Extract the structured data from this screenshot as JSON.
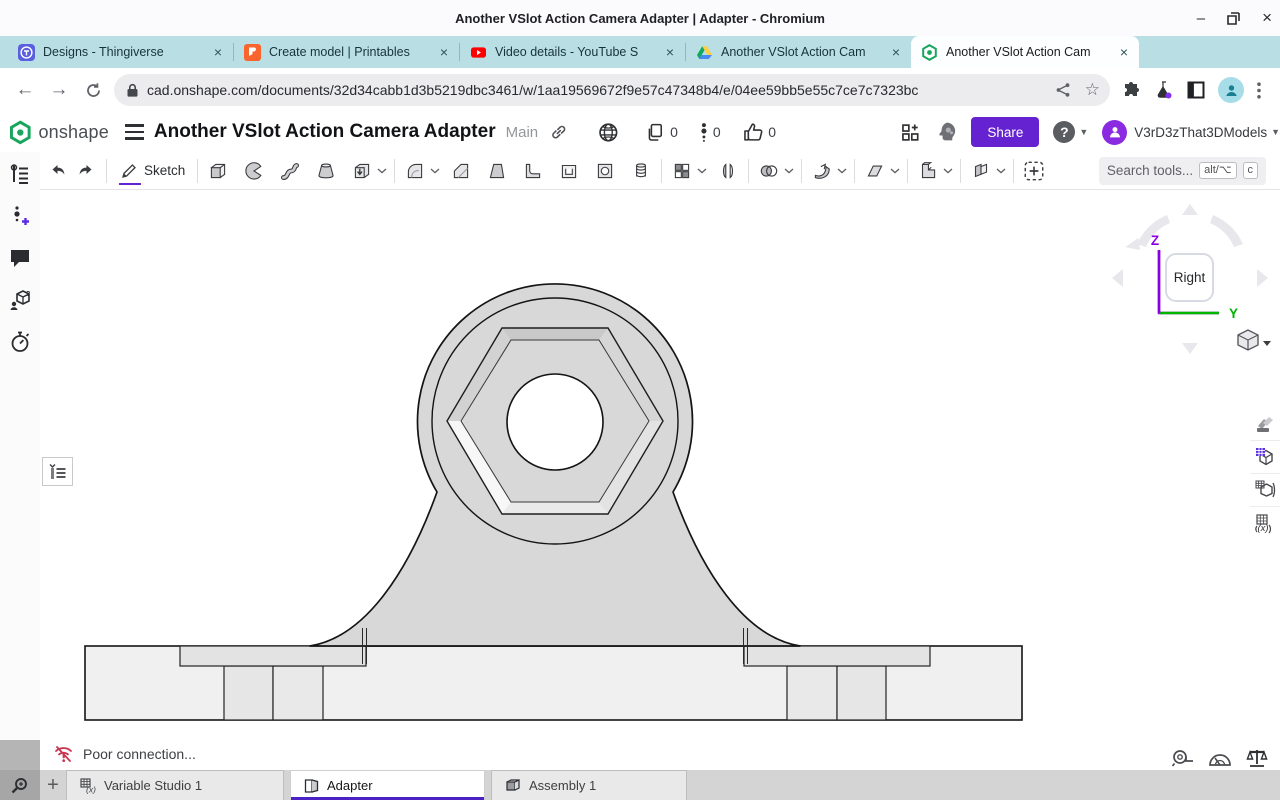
{
  "window": {
    "title": "Another VSlot Action Camera Adapter | Adapter - Chromium"
  },
  "browser": {
    "tabs": [
      {
        "label": "Designs - Thingiverse",
        "icon": "thingiverse"
      },
      {
        "label": "Create model | Printables",
        "icon": "printables"
      },
      {
        "label": "Video details - YouTube S",
        "icon": "youtube"
      },
      {
        "label": "Another VSlot Action Cam",
        "icon": "google-drive"
      },
      {
        "label": "Another VSlot Action Cam",
        "icon": "onshape"
      }
    ],
    "url": "cad.onshape.com/documents/32d34cabb1d3b5219dbc3461/w/1aa19569672f9e57c47348b4/e/04ee59bb5e55c7ce7c7323bc"
  },
  "header": {
    "brand": "onshape",
    "title": "Another VSlot Action Camera Adapter",
    "workspace": "Main",
    "copies_count": "0",
    "versions_count": "0",
    "likes_count": "0",
    "share_label": "Share",
    "user_name": "V3rD3zThat3DModels"
  },
  "toolbar": {
    "sketch_label": "Sketch",
    "search_placeholder": "Search tools...",
    "shortcut_alt": "alt/⌥",
    "shortcut_key": "c",
    "tools": [
      "undo",
      "redo",
      "sketch",
      "extrude",
      "revolve",
      "sweep",
      "loft",
      "thicken",
      "fillet",
      "chamfer",
      "draft",
      "rib",
      "shell",
      "hole",
      "thread",
      "linear-pattern",
      "mirror",
      "boolean",
      "split",
      "plane",
      "transform",
      "surface",
      "custom-feature"
    ]
  },
  "viewcube": {
    "face_label": "Right",
    "axis_z": "Z",
    "axis_y": "Y"
  },
  "status": {
    "message": "Poor connection..."
  },
  "doc_tabs": [
    {
      "label": "Variable Studio 1"
    },
    {
      "label": "Adapter"
    },
    {
      "label": "Assembly 1"
    }
  ],
  "colors": {
    "accent_purple": "#6522d0",
    "doc_tab_underline": "#4b22c4",
    "tab_strip_teal": "#b9dfe4",
    "axis_z_purple": "#8a00e0",
    "axis_y_green": "#00b400",
    "status_red": "#c8374f",
    "onshape_green": "#17a65b",
    "model_gray": "#d8d8d8"
  }
}
